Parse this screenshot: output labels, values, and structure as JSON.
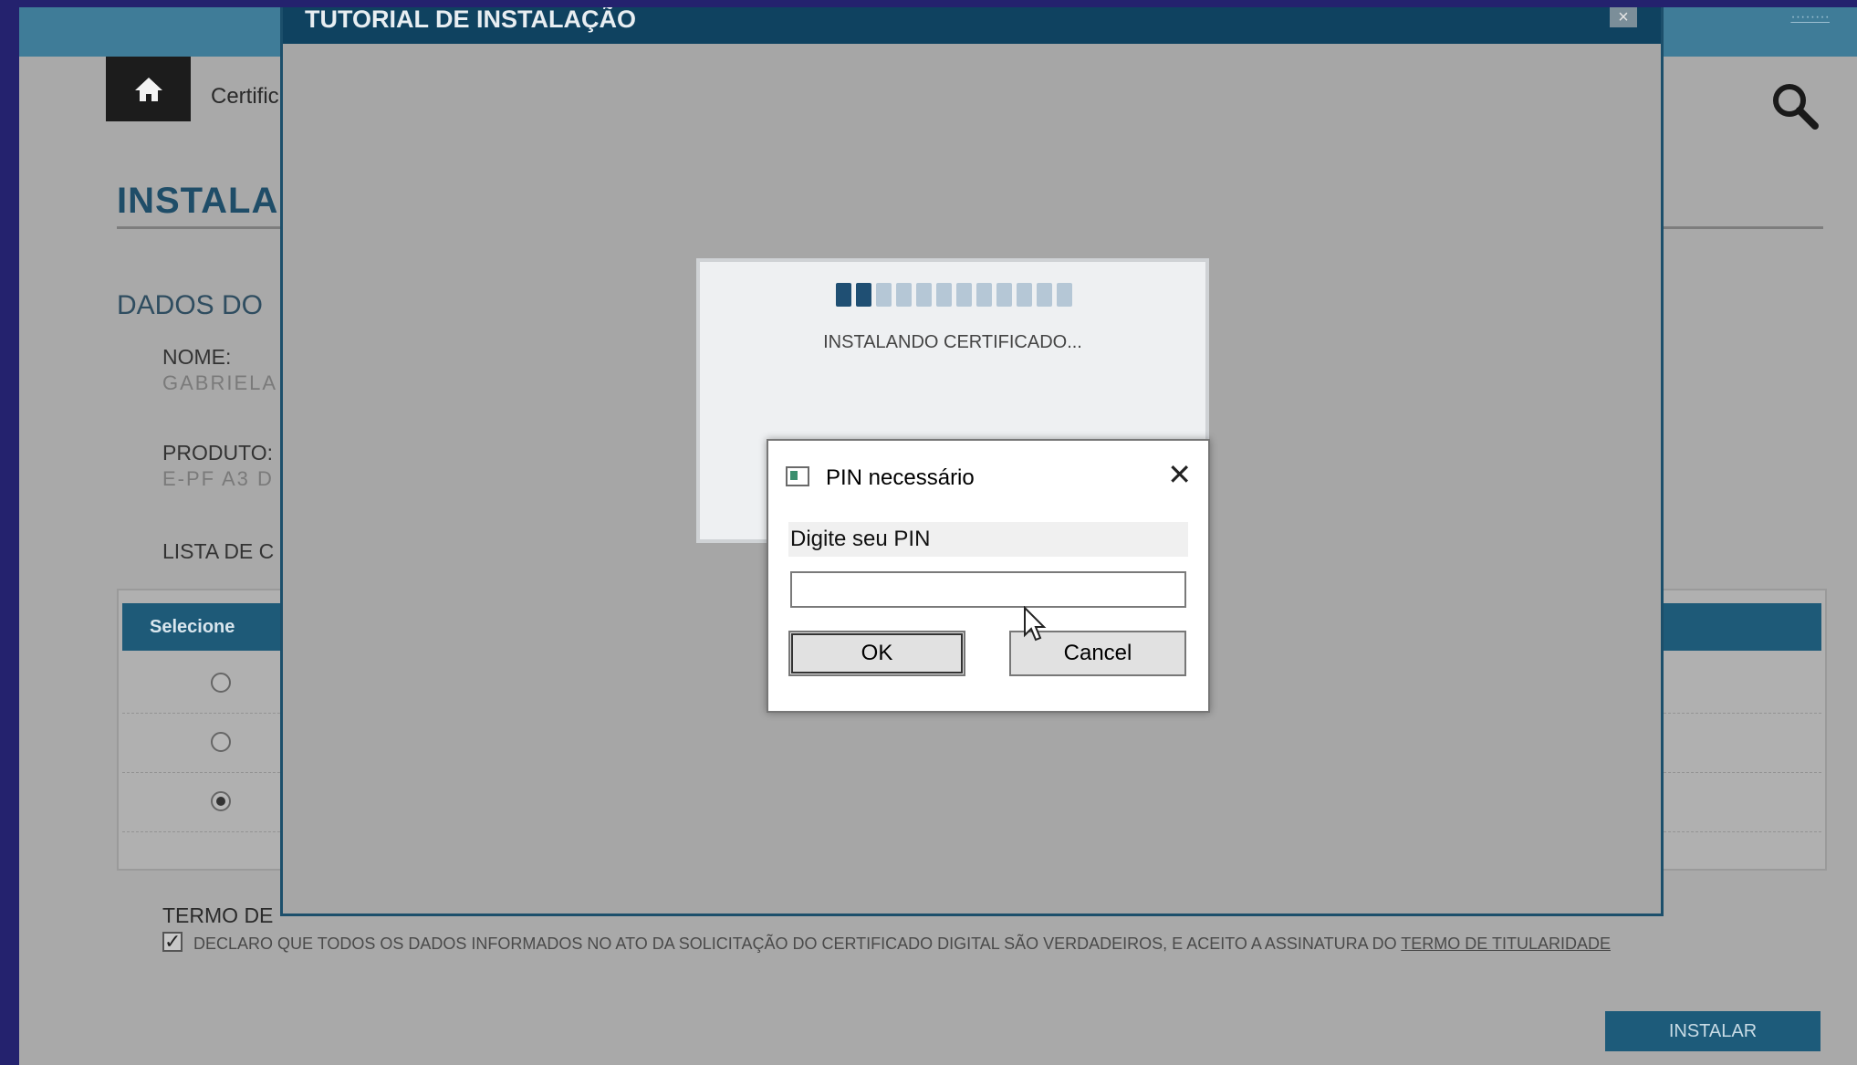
{
  "page": {
    "breadcrumb": "Certific",
    "title": "INSTALA",
    "section_title": "DADOS DO",
    "fields": {
      "name_label": "NOME:",
      "name_value": "GABRIELA",
      "product_label": "PRODUTO:",
      "product_value": "E-PF A3 D",
      "list_label": "LISTA DE C"
    },
    "table": {
      "header_label": "Selecione",
      "rows": [
        {
          "selected": false
        },
        {
          "selected": false
        },
        {
          "selected": true
        }
      ]
    },
    "terms": {
      "title": "TERMO DE",
      "checked": true,
      "text": "DECLARO QUE TODOS OS DADOS INFORMADOS NO ATO DA SOLICITAÇÃO DO CERTIFICADO DIGITAL SÃO VERDADEIROS, E ACEITO A ASSINATURA DO ",
      "link": "TERMO DE TITULARIDADE"
    },
    "install_button": "INSTALAR"
  },
  "modal": {
    "title": "TUTORIAL DE INSTALAÇÃO",
    "close_glyph": "×",
    "installing": {
      "status": "INSTALANDO CERTIFICADO...",
      "progress_segments_total": 12,
      "progress_segments_filled": 2
    }
  },
  "pin_dialog": {
    "title": "PIN necessário",
    "prompt": "Digite seu PIN",
    "input_value": "",
    "ok_label": "OK",
    "cancel_label": "Cancel",
    "close_glyph": "✕"
  },
  "colors": {
    "background_frame": "#24226e",
    "header_blue": "#0f4260",
    "accent": "#1d5b7a"
  }
}
